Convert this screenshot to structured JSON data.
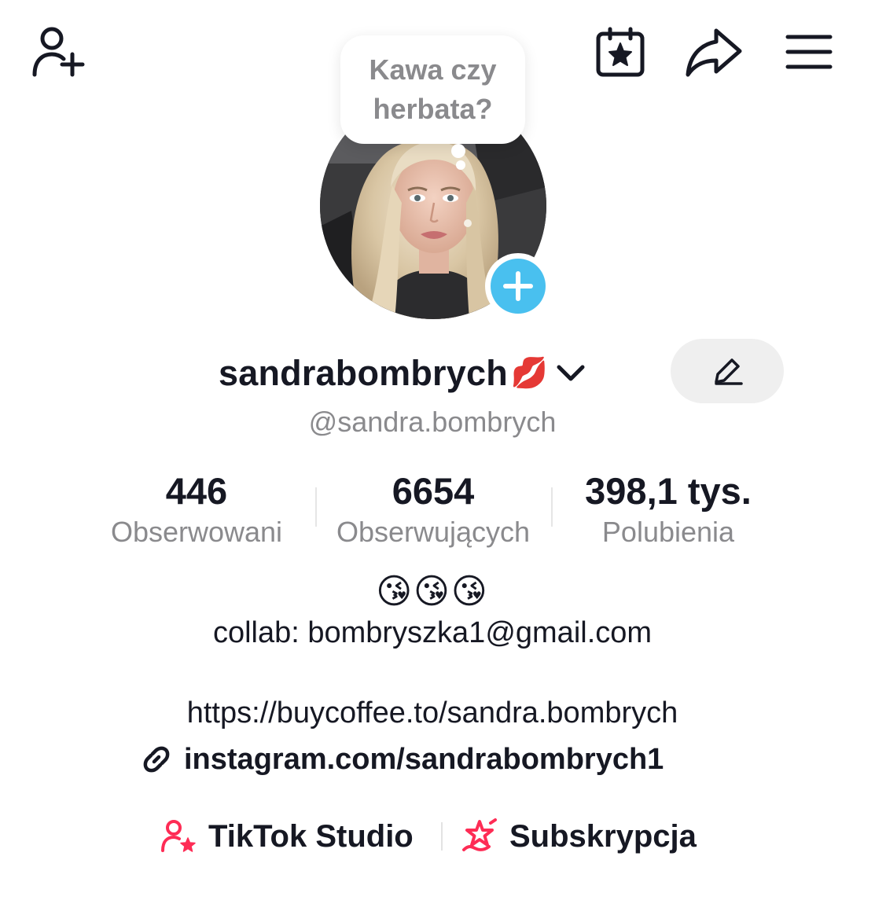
{
  "header": {
    "icons": [
      "add-friend-icon",
      "calendar-star-icon",
      "share-icon",
      "menu-icon"
    ]
  },
  "profile": {
    "note_bubble": "Kawa czy herbata?",
    "username": "sandrabombrych",
    "username_emoji": "💋",
    "handle": "@sandra.bombrych"
  },
  "stats": [
    {
      "value": "446",
      "label": "Obserwowani"
    },
    {
      "value": "6654",
      "label": "Obserwujących"
    },
    {
      "value": "398,1 tys.",
      "label": "Polubienia"
    }
  ],
  "bio": {
    "emojis": "😘😘😘",
    "contact": "collab: bombryszka1@gmail.com",
    "url": "https://buycoffee.to/sandra.bombrych",
    "link": "instagram.com/sandrabombrych1"
  },
  "actions": [
    {
      "label": "TikTok Studio",
      "icon": "creator-star-icon"
    },
    {
      "label": "Subskrypcja",
      "icon": "subscription-star-icon"
    }
  ],
  "colors": {
    "text": "#161823",
    "secondary_text": "#8a8a8d",
    "accent_pink": "#fe2c55",
    "add_badge": "#49c0ef",
    "edit_button_bg": "#efefef"
  }
}
